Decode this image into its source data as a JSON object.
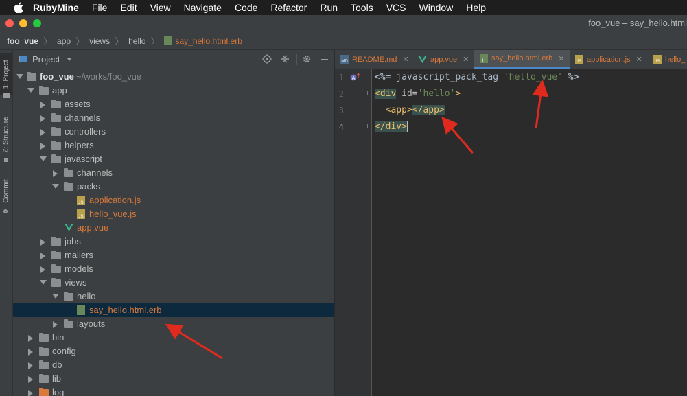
{
  "menubar": {
    "app": "RubyMine",
    "items": [
      "File",
      "Edit",
      "View",
      "Navigate",
      "Code",
      "Refactor",
      "Run",
      "Tools",
      "VCS",
      "Window",
      "Help"
    ]
  },
  "window": {
    "title": "foo_vue – say_hello.html"
  },
  "breadcrumb": [
    "foo_vue",
    "app",
    "views",
    "hello",
    "say_hello.html.erb"
  ],
  "stripe": {
    "project": "1: Project",
    "structure": "Z: Structure",
    "commit": "Commit"
  },
  "project_panel": {
    "title": "Project",
    "tree": [
      {
        "label": "foo_vue",
        "extra": "~/works/foo_vue",
        "kind": "folder",
        "expanded": true
      },
      {
        "label": "app",
        "kind": "folder",
        "expanded": true
      },
      {
        "label": "assets",
        "kind": "folder",
        "expanded": false
      },
      {
        "label": "channels",
        "kind": "folder",
        "expanded": false
      },
      {
        "label": "controllers",
        "kind": "folder",
        "expanded": false
      },
      {
        "label": "helpers",
        "kind": "folder",
        "expanded": false
      },
      {
        "label": "javascript",
        "kind": "folder",
        "expanded": true
      },
      {
        "label": "channels",
        "kind": "folder",
        "expanded": false
      },
      {
        "label": "packs",
        "kind": "folder",
        "expanded": true
      },
      {
        "label": "application.js",
        "kind": "js-file"
      },
      {
        "label": "hello_vue.js",
        "kind": "js-file"
      },
      {
        "label": "app.vue",
        "kind": "vue-file"
      },
      {
        "label": "jobs",
        "kind": "folder",
        "expanded": false
      },
      {
        "label": "mailers",
        "kind": "folder",
        "expanded": false
      },
      {
        "label": "models",
        "kind": "folder",
        "expanded": false
      },
      {
        "label": "views",
        "kind": "folder",
        "expanded": true
      },
      {
        "label": "hello",
        "kind": "folder",
        "expanded": true
      },
      {
        "label": "say_hello.html.erb",
        "kind": "erb-file",
        "selected": true
      },
      {
        "label": "layouts",
        "kind": "folder",
        "expanded": false
      },
      {
        "label": "bin",
        "kind": "folder",
        "expanded": false
      },
      {
        "label": "config",
        "kind": "folder",
        "expanded": false
      },
      {
        "label": "db",
        "kind": "folder",
        "expanded": false
      },
      {
        "label": "lib",
        "kind": "folder",
        "expanded": false
      },
      {
        "label": "log",
        "kind": "folder",
        "expanded": false
      }
    ]
  },
  "tabs": [
    {
      "label": "README.md",
      "icon": "md-file-icon"
    },
    {
      "label": "app.vue",
      "icon": "vue-file-icon"
    },
    {
      "label": "say_hello.html.erb",
      "icon": "erb-file-icon",
      "active": true
    },
    {
      "label": "application.js",
      "icon": "js-file-icon"
    },
    {
      "label": "hello_",
      "icon": "js-file-icon"
    }
  ],
  "editor": {
    "line_numbers": [
      "1",
      "2",
      "3",
      "4"
    ],
    "lines": [
      {
        "erb_open": "<%=",
        "method": " javascript_pack_tag ",
        "arg": "'hello_vue'",
        "erb_close": " %>"
      },
      {
        "open": "<div",
        "attr": " id=",
        "val": "'hello'",
        "close": ">"
      },
      {
        "indent": "  ",
        "tag_open": "<app>",
        "tag_close": "</app>"
      },
      {
        "tag": "</div>"
      }
    ]
  },
  "colors": {
    "accent": "#4a88c7",
    "annotation_arrow": "#e02a1e",
    "file_modified": "#d9793b"
  }
}
